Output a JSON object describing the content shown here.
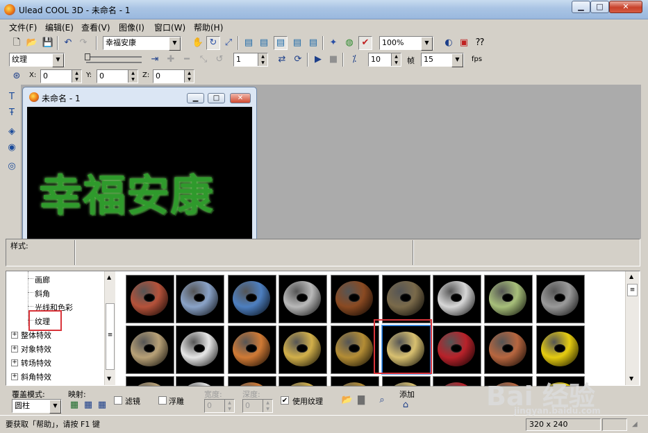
{
  "window": {
    "title": "Ulead COOL 3D - 未命名 - 1",
    "min": "▁",
    "max": "□",
    "close": "✕"
  },
  "menu": [
    "文件(F)",
    "编辑(E)",
    "查看(V)",
    "图像(I)",
    "窗口(W)",
    "帮助(H)"
  ],
  "toolbar1": {
    "text_combo": "幸福安康",
    "zoom_combo": "100%"
  },
  "toolbar2": {
    "category_combo": "纹理",
    "frame_value": "1",
    "frame_count": "10",
    "frame_label": "帧",
    "fps_value": "15",
    "fps_label": "fps"
  },
  "toolbar3": {
    "x_label": "X:",
    "x_value": "0",
    "y_label": "Y:",
    "y_value": "0",
    "z_label": "Z:",
    "z_value": "0"
  },
  "child_window": {
    "title": "未命名 - 1",
    "canvas_text": "幸福安康"
  },
  "style_bar": {
    "label": "样式:"
  },
  "tree": {
    "children": [
      "画廊",
      "斜角",
      "光线和色彩",
      "纹理"
    ],
    "selected": "纹理",
    "groups": [
      "整体特效",
      "对象特效",
      "转场特效",
      "斜角特效"
    ]
  },
  "thumbnails": {
    "row1": [
      "brick-red",
      "blue-marble",
      "blue-stone",
      "gray-brick",
      "brown-wood",
      "leopard",
      "silver-crackle",
      "green-moss",
      "gray-granite"
    ],
    "row2": [
      "sand",
      "chrome-silver",
      "orange-wood",
      "gold",
      "dark-gold",
      "gold-chrome",
      "red-brick",
      "terracotta-brick",
      "yellow"
    ],
    "selected_index": 5,
    "colors": {
      "brick-red": "#b5523a",
      "blue-marble": "#8aa3c8",
      "blue-stone": "#4d7fc0",
      "gray-brick": "#b9b9b9",
      "brown-wood": "#8a4a22",
      "leopard": "#7a6a4a",
      "silver-crackle": "#d7d7d7",
      "green-moss": "#a7bf7a",
      "gray-granite": "#9a9a9a",
      "sand": "#b8a177",
      "chrome-silver": "#e6e6e6",
      "orange-wood": "#d07a35",
      "gold": "#d2b04a",
      "dark-gold": "#b48d35",
      "gold-chrome": "#d8c070",
      "red-brick": "#b8222a",
      "terracotta-brick": "#b7663f",
      "yellow": "#e6cc10"
    }
  },
  "bottom": {
    "overlay_label": "覆盖模式:",
    "overlay_value": "圆柱",
    "mapping_label": "映射:",
    "filter_label": "滤镜",
    "emboss_label": "浮雕",
    "width_label": "宽度:",
    "width_value": "0",
    "depth_label": "深度:",
    "depth_value": "0",
    "use_texture_label": "使用纹理",
    "add_label": "添加"
  },
  "status": {
    "help_text": "要获取「帮助」，请按 F1 键",
    "size": "320 x 240"
  },
  "watermark": {
    "brand": "Bai 经验",
    "url": "jingyan.baidu.com"
  }
}
